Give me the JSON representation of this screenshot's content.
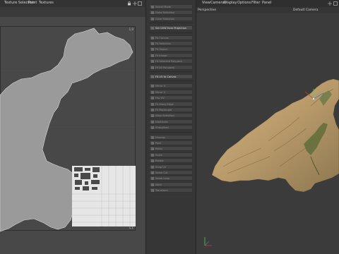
{
  "uv_menu": {
    "items": [
      "Texture Selection",
      "Paint",
      "Textures"
    ]
  },
  "uv_canvas": {
    "corner_top_right": "1,0",
    "corner_bottom_right": "1,1"
  },
  "tools": {
    "items": [
      {
        "label": "Select Mode",
        "active": false
      },
      {
        "label": "Grow Selection",
        "active": false
      },
      {
        "label": "Clear Selection",
        "active": false
      },
      {
        "label": "Set UVW from Projection",
        "active": true
      },
      {
        "label": "Fit Canvas",
        "active": false
      },
      {
        "label": "Fit Selection",
        "active": false
      },
      {
        "label": "Fit Object",
        "active": false
      },
      {
        "label": "Fit Image",
        "active": false
      },
      {
        "label": "Fit Selected Polygons",
        "active": false
      },
      {
        "label": "Fit All Polygons",
        "active": false
      },
      {
        "label": "Fit UV to Canvas",
        "active": true
      },
      {
        "label": "Mirror U",
        "active": false
      },
      {
        "label": "Mirror V",
        "active": false
      },
      {
        "label": "Flip UV",
        "active": false
      },
      {
        "label": "Fit Along Edge",
        "active": false
      },
      {
        "label": "Fit Rectangle",
        "active": false
      },
      {
        "label": "Align Selection",
        "active": false
      },
      {
        "label": "Distribute",
        "active": false
      },
      {
        "label": "Straighten",
        "active": false
      },
      {
        "label": "Unwrap",
        "active": false
      },
      {
        "label": "Pack",
        "active": false
      },
      {
        "label": "Relax",
        "active": false
      },
      {
        "label": "Scale",
        "active": false
      },
      {
        "label": "Rotate",
        "active": false
      },
      {
        "label": "Snap UV",
        "active": false
      },
      {
        "label": "Seam Cut",
        "active": false
      },
      {
        "label": "Seam Loop",
        "active": false
      },
      {
        "label": "Weld",
        "active": false
      },
      {
        "label": "Transform",
        "active": false
      }
    ]
  },
  "viewport_menu": {
    "items": [
      "View",
      "Cameras",
      "Display",
      "Options",
      "Filter",
      "Panel"
    ]
  },
  "viewport": {
    "view_name": "Perspective",
    "camera": "Default Camera"
  },
  "colors": {
    "active_tool": "#4b4b4b",
    "terrain_light": "#c9a878",
    "terrain_dark": "#7a6a4a",
    "vegetation": "#5f6f3a",
    "axis_x": "#d23a3a",
    "axis_y": "#4ad14a",
    "axis_z": "#3a78d2"
  }
}
